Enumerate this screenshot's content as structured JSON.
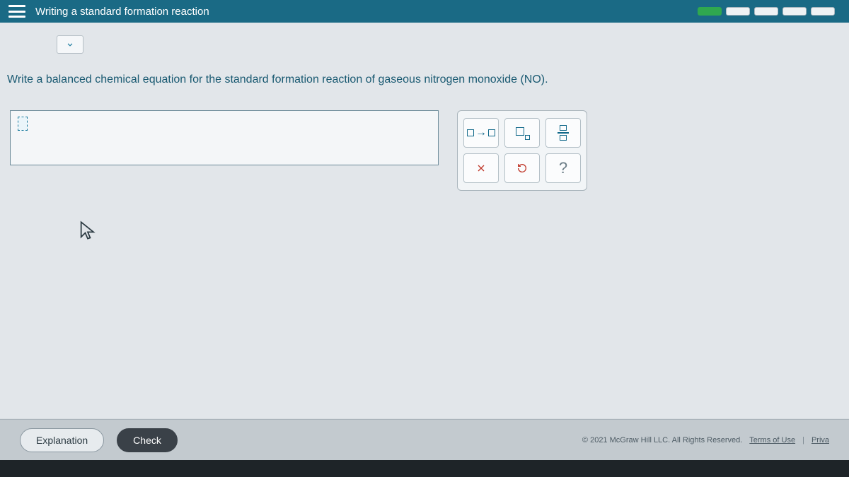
{
  "header": {
    "title": "Writing a standard formation reaction"
  },
  "question": {
    "prompt_prefix": "Write a balanced chemical equation for the standard formation reaction of gaseous nitrogen monoxide ",
    "formula": "(NO)",
    "prompt_suffix": "."
  },
  "tools": {
    "arrow": "→",
    "clear": "×",
    "help": "?"
  },
  "footer": {
    "explanation_label": "Explanation",
    "check_label": "Check",
    "copyright": "© 2021 McGraw Hill LLC. All Rights Reserved.",
    "terms": "Terms of Use",
    "privacy": "Priva"
  }
}
